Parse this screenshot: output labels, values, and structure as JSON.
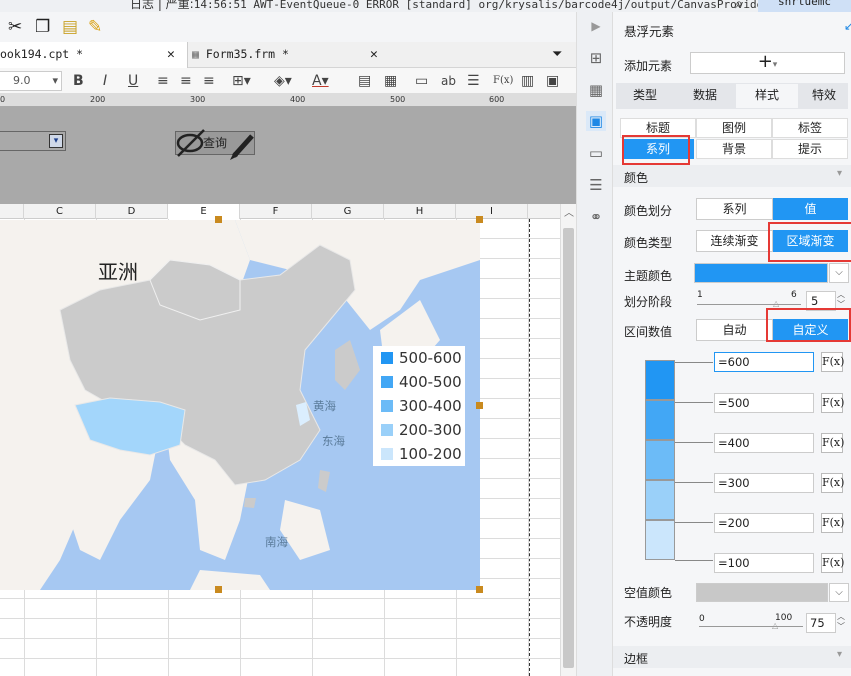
{
  "topbar": {
    "log_prefix": "日志 | 严重:",
    "log_text": "14:56:51 AWT-EventQueue-0 ERROR [standard] org/krysalis/barcode4j/output/CanvasProvider",
    "user": "snrtuemc"
  },
  "tabs": [
    {
      "label": "ook194.cpt *"
    },
    {
      "label": "Form35.frm *"
    }
  ],
  "format": {
    "font_size": "9.0",
    "bold": "B",
    "italic": "I",
    "underline": "U",
    "fx": "F(x)",
    "ab": "ab"
  },
  "ruler": [
    "200",
    "300",
    "400",
    "500",
    "600"
  ],
  "param": {
    "query_label": "查询"
  },
  "columns": [
    "C",
    "D",
    "E",
    "F",
    "G",
    "H",
    "I"
  ],
  "map": {
    "title": "亚洲",
    "sea_yellow": "黄海",
    "sea_east": "东海",
    "sea_south": "南海"
  },
  "legend": [
    {
      "label": "500-600",
      "color": "#2196f3"
    },
    {
      "label": "400-500",
      "color": "#42a7f5"
    },
    {
      "label": "300-400",
      "color": "#6cbbf7"
    },
    {
      "label": "200-300",
      "color": "#9ad0f9"
    },
    {
      "label": "100-200",
      "color": "#cbe6fc"
    }
  ],
  "panel": {
    "title": "悬浮元素",
    "add_label": "添加元素",
    "add_btn": "+",
    "main_tabs": [
      {
        "label": "类型"
      },
      {
        "label": "数据"
      },
      {
        "label": "样式"
      },
      {
        "label": "特效"
      }
    ],
    "sub_tabs_row1": [
      {
        "label": "标题"
      },
      {
        "label": "图例"
      },
      {
        "label": "标签"
      }
    ],
    "sub_tabs_row2": [
      {
        "label": "系列"
      },
      {
        "label": "背景"
      },
      {
        "label": "提示"
      }
    ],
    "color_section": "颜色",
    "color_div_label": "颜色划分",
    "color_div_opts": [
      {
        "label": "系列"
      },
      {
        "label": "值"
      }
    ],
    "color_type_label": "颜色类型",
    "color_type_opts": [
      {
        "label": "连续渐变"
      },
      {
        "label": "区域渐变"
      }
    ],
    "theme_color_label": "主题颜色",
    "theme_color": "#2196f3",
    "stage_label": "划分阶段",
    "stage_min": "1",
    "stage_max": "6",
    "stage_value": "5",
    "interval_label": "区间数值",
    "interval_opts": [
      {
        "label": "自动"
      },
      {
        "label": "自定义"
      }
    ],
    "ranges": [
      {
        "value": "=600",
        "color": "#2196f3"
      },
      {
        "value": "=500",
        "color": "#42a7f5"
      },
      {
        "value": "=400",
        "color": "#6cbbf7"
      },
      {
        "value": "=300",
        "color": "#9ad0f9"
      },
      {
        "value": "=200",
        "color": "#cbe6fc"
      },
      {
        "value": "=100"
      }
    ],
    "fx_label": "F(x)",
    "empty_color_label": "空值颜色",
    "opacity_label": "不透明度",
    "opacity_min": "0",
    "opacity_max": "100",
    "opacity_value": "75",
    "border_section": "边框"
  }
}
